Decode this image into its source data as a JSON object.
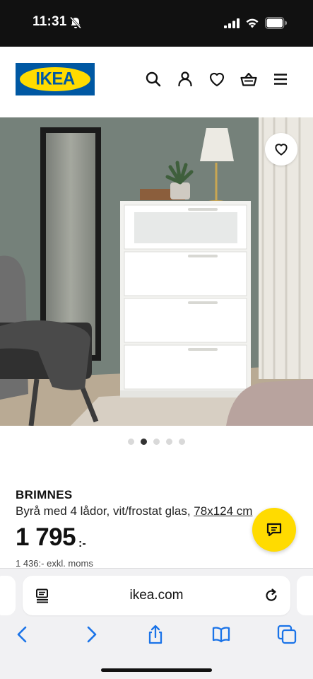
{
  "status_bar": {
    "time": "11:31"
  },
  "header": {
    "logo_text": "IKEA",
    "icons": [
      "search-icon",
      "user-icon",
      "heart-icon",
      "basket-icon",
      "menu-icon"
    ]
  },
  "carousel": {
    "image_count": 5,
    "active_index": 1
  },
  "product": {
    "name": "BRIMNES",
    "description": "Byrå med 4 lådor, vit/frostat glas, ",
    "dimensions": "78x124 cm",
    "price": "1 795",
    "price_suffix": ":-",
    "price_ex_vat": "1 436:- exkl. moms"
  },
  "browser": {
    "url": "ikea.com"
  },
  "colors": {
    "ikea_blue": "#0058a3",
    "ikea_yellow": "#ffdb00",
    "ios_blue": "#1a73e8"
  }
}
